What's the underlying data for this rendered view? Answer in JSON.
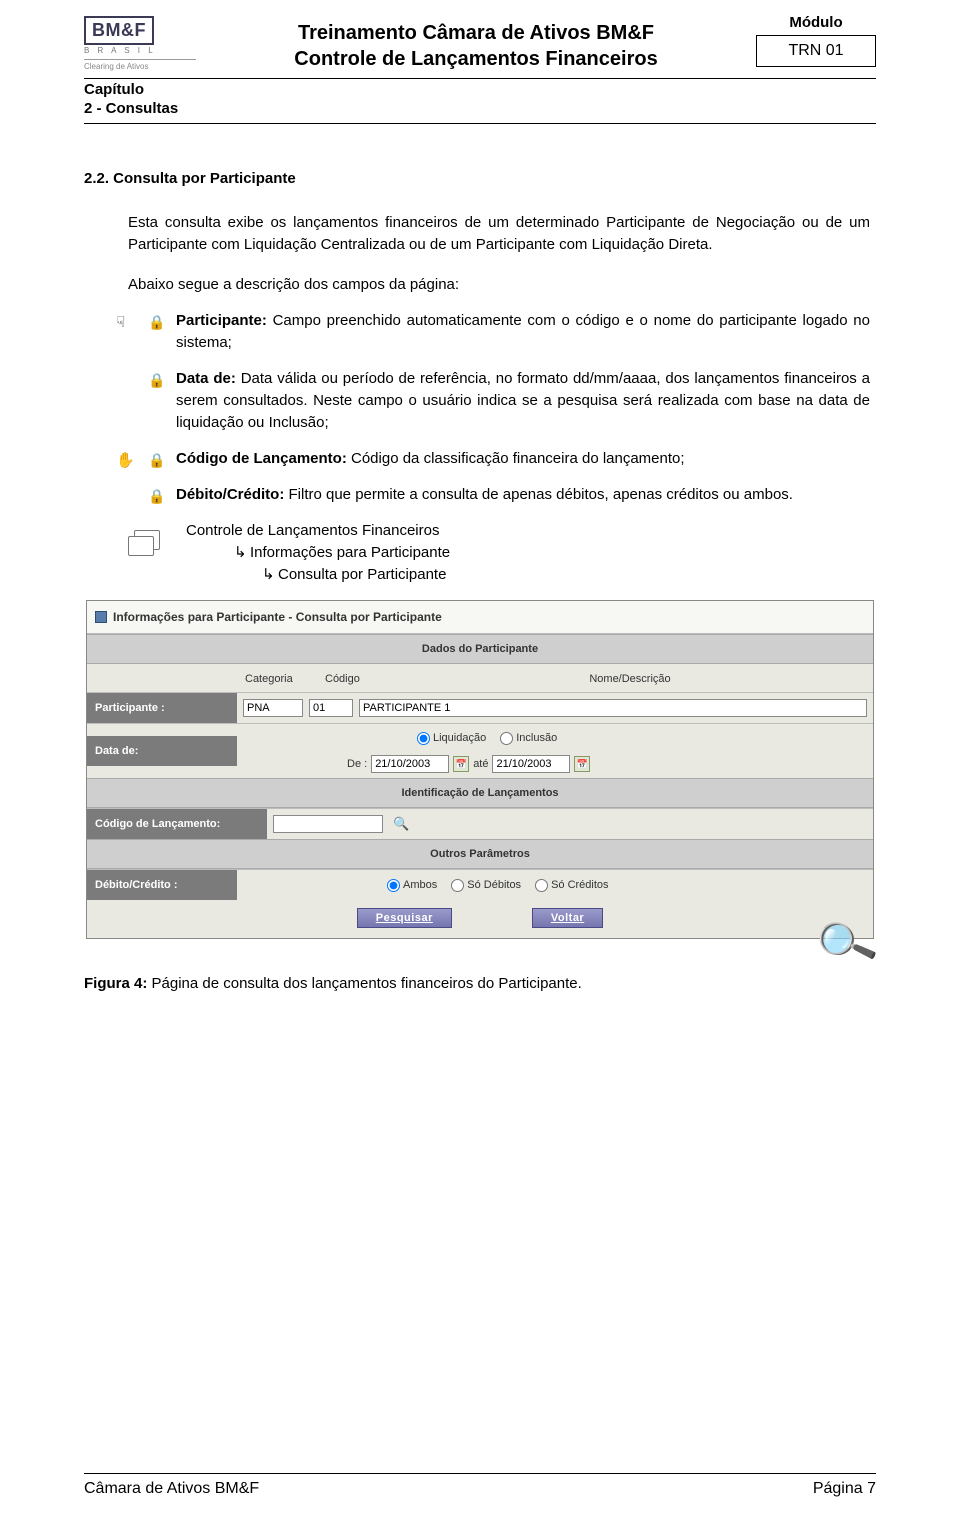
{
  "header": {
    "logo_text": "BM&F",
    "logo_country": "B R A S I L",
    "logo_sub": "Clearing de Ativos",
    "title_line1": "Treinamento Câmara de Ativos BM&F",
    "title_line2": "Controle de Lançamentos Financeiros",
    "module_label": "Módulo",
    "module_code": "TRN 01"
  },
  "chapter": {
    "label": "Capítulo",
    "value": "2 - Consultas"
  },
  "section": {
    "number_title": "2.2. Consulta por Participante",
    "para1": "Esta consulta exibe os lançamentos financeiros de um determinado Participante de Negociação ou de um Participante com Liquidação Centralizada ou de um Participante com Liquidação Direta.",
    "para2": "Abaixo segue a descrição dos campos da página:"
  },
  "bullets": {
    "b1_title": "Participante:",
    "b1_text": " Campo preenchido automaticamente com o código e o nome do participante logado no sistema;",
    "b2_title": "Data de:",
    "b2_text": " Data válida ou período de referência, no formato dd/mm/aaaa, dos lançamentos financeiros a serem consultados. Neste campo o usuário indica se a pesquisa será realizada com base na data de liquidação ou Inclusão;",
    "b3_title": "Código de Lançamento:",
    "b3_text": " Código da classificação financeira do lançamento;",
    "b4_title": "Débito/Crédito:",
    "b4_text": " Filtro que permite a consulta de apenas débitos, apenas créditos ou ambos."
  },
  "nav": {
    "l1": "Controle de Lançamentos Financeiros",
    "l2": "Informações para Participante",
    "l3": "Consulta por Participante"
  },
  "form": {
    "window_title": "Informações para Participante - Consulta por Participante",
    "sect_dados": "Dados do Participante",
    "col_categoria": "Categoria",
    "col_codigo": "Código",
    "col_nome": "Nome/Descrição",
    "row_participante": "Participante :",
    "val_categoria": "PNA",
    "val_codigo": "01",
    "val_nome": "PARTICIPANTE 1",
    "row_data": "Data de:",
    "radio_liq": "Liquidação",
    "radio_inc": "Inclusão",
    "de_label": "De :",
    "date_from": "21/10/2003",
    "ate_label": "até",
    "date_to": "21/10/2003",
    "sect_ident": "Identificação de Lançamentos",
    "row_codlanc": "Código de Lançamento:",
    "sect_outros": "Outros Parâmetros",
    "row_dc": "Débito/Crédito :",
    "radio_ambos": "Ambos",
    "radio_deb": "Só Débitos",
    "radio_cred": "Só Créditos",
    "btn_pesquisar": "Pesquisar",
    "btn_voltar": "Voltar"
  },
  "figure": {
    "label": "Figura 4:",
    "text": " Página de consulta dos lançamentos financeiros do Participante."
  },
  "footer": {
    "left": "Câmara de Ativos BM&F",
    "right": "Página 7"
  }
}
